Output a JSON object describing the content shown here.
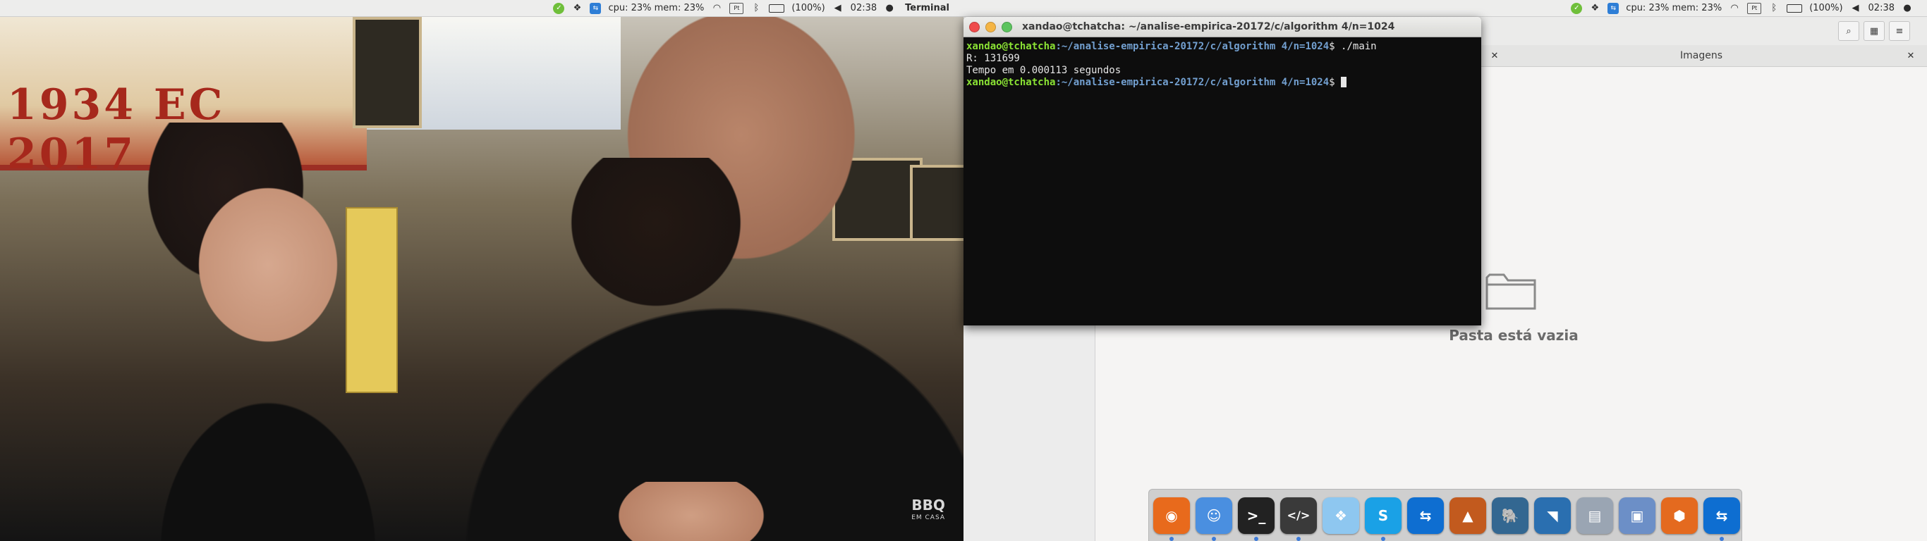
{
  "topbar": {
    "cpu_mem": "cpu: 23% mem: 23%",
    "battery": "(100%)",
    "time": "02:38",
    "app_name": "Terminal"
  },
  "video": {
    "banner_text": "1934 EC 2017",
    "watermark_big": "BBQ",
    "watermark_small": "EM CASA"
  },
  "terminal": {
    "title": "xandao@tchatcha: ~/analise-empirica-20172/c/algorithm 4/n=1024",
    "prompt_user": "xandao@tchatcha",
    "prompt_path": ":~/analise-empirica-20172/c/algorithm 4/n=1024",
    "prompt_symbol": "$ ",
    "command": "./main",
    "output_1": "R: 131699",
    "output_2": "Tempo em 0.000113 segundos"
  },
  "filemanager": {
    "tab_title": "Imagens",
    "empty_message": "Pasta está vazia"
  },
  "dock": {
    "items": [
      "firefox-icon",
      "finder-icon",
      "terminal-icon",
      "code-editor-icon",
      "dropbox-icon",
      "skype-icon",
      "teamviewer-icon",
      "matlab-icon",
      "postgresql-icon",
      "mysql-workbench-icon",
      "disk-utility-icon",
      "virtualbox-icon",
      "ubuntu-icon",
      "teamviewer-alt-icon"
    ]
  },
  "colors": {
    "terminal_user": "#8ae234",
    "terminal_path": "#729fcf",
    "close_button": "#ef4b4b",
    "minimize_button": "#f5b544",
    "maximize_button": "#5cc45e"
  }
}
